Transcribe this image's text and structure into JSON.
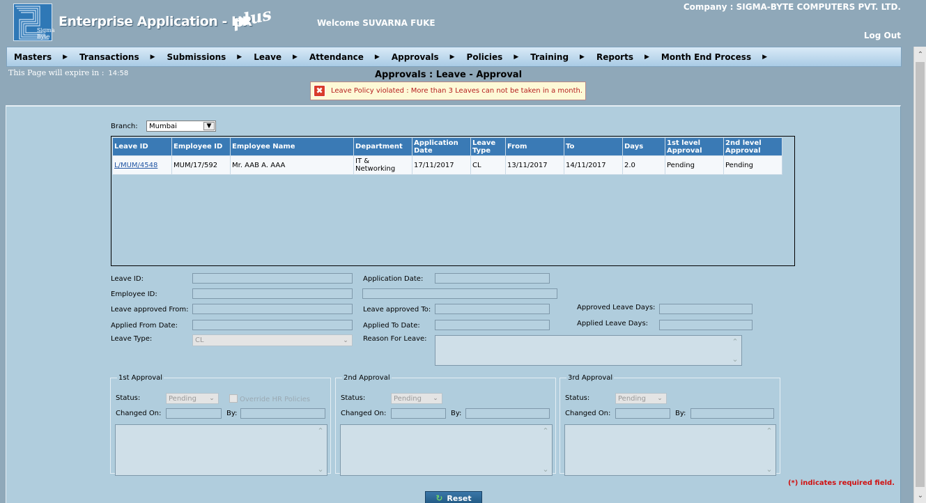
{
  "header": {
    "logo_text": "Sigma Byte",
    "app_title": "Enterprise Application - HR",
    "app_plus": "plus",
    "welcome": "Welcome SUVARNA FUKE",
    "company": "Company : SIGMA-BYTE COMPUTERS PVT. LTD.",
    "logout": "Log Out"
  },
  "menu": [
    {
      "label": "Masters"
    },
    {
      "label": "Transactions"
    },
    {
      "label": "Submissions"
    },
    {
      "label": "Leave"
    },
    {
      "label": "Attendance"
    },
    {
      "label": "Approvals"
    },
    {
      "label": "Policies"
    },
    {
      "label": "Training"
    },
    {
      "label": "Reports"
    },
    {
      "label": "Month End Process"
    }
  ],
  "expire": {
    "label": "This Page will expire in :",
    "time": "14:58"
  },
  "page_title": "Approvals : Leave - Approval",
  "error": {
    "icon": "error-x-icon",
    "message": "Leave Policy violated : More than 3 Leaves can not be taken in a month."
  },
  "branch": {
    "label": "Branch:",
    "value": "Mumbai"
  },
  "grid": {
    "headers": [
      "Leave ID",
      "Employee ID",
      "Employee Name",
      "Department",
      "Application Date",
      "Leave Type",
      "From",
      "To",
      "Days",
      "1st level Approval",
      "2nd level Approval"
    ],
    "rows": [
      [
        "L/MUM/4548",
        "MUM/17/592",
        "Mr. AAB A. AAA",
        "IT & Networking",
        "17/11/2017",
        "CL",
        "13/11/2017",
        "14/11/2017",
        "2.0",
        "Pending",
        "Pending"
      ]
    ]
  },
  "form": {
    "leave_id": "Leave ID:",
    "employee_id": "Employee ID:",
    "leave_approved_from": "Leave approved From:",
    "applied_from_date": "Applied From Date:",
    "leave_type": "Leave Type:",
    "leave_type_value": "CL",
    "application_date": "Application Date:",
    "leave_approved_to": "Leave approved To:",
    "applied_to_date": "Applied To Date:",
    "reason_for_leave": "Reason For Leave:",
    "approved_leave_days": "Approved Leave Days:",
    "applied_leave_days": "Applied Leave Days:"
  },
  "approvals": [
    {
      "legend": "1st Approval",
      "status_label": "Status:",
      "status_value": "Pending",
      "override": "Override HR Policies",
      "changed_on": "Changed On:",
      "by": "By:"
    },
    {
      "legend": "2nd Approval",
      "status_label": "Status:",
      "status_value": "Pending",
      "changed_on": "Changed On:",
      "by": "By:"
    },
    {
      "legend": "3rd Approval",
      "status_label": "Status:",
      "status_value": "Pending",
      "changed_on": "Changed On:",
      "by": "By:"
    }
  ],
  "required_note": "(*) indicates required field.",
  "reset_label": "Reset"
}
